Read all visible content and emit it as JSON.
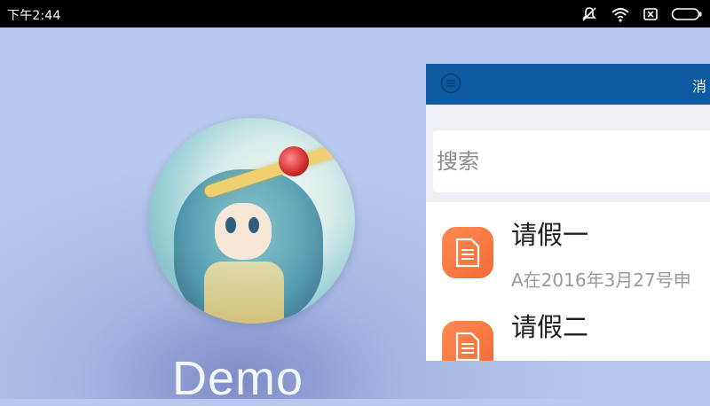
{
  "status_bar": {
    "time": "下午2:44",
    "icons": [
      "mute-icon",
      "wifi-icon",
      "sim-icon",
      "battery-icon"
    ]
  },
  "profile": {
    "username": "Demo"
  },
  "app_panel": {
    "header_title": "消",
    "menu_icon": "menu-icon",
    "search": {
      "placeholder": "搜索",
      "value": ""
    },
    "items": [
      {
        "icon": "document-icon",
        "title": "请假一",
        "subtitle": "A在2016年3月27号申"
      },
      {
        "icon": "document-icon",
        "title": "请假二",
        "subtitle": ""
      }
    ],
    "colors": {
      "header": "#0d5aa0",
      "accent_icon": "#f26b3a",
      "background": "#eef0f6"
    }
  }
}
